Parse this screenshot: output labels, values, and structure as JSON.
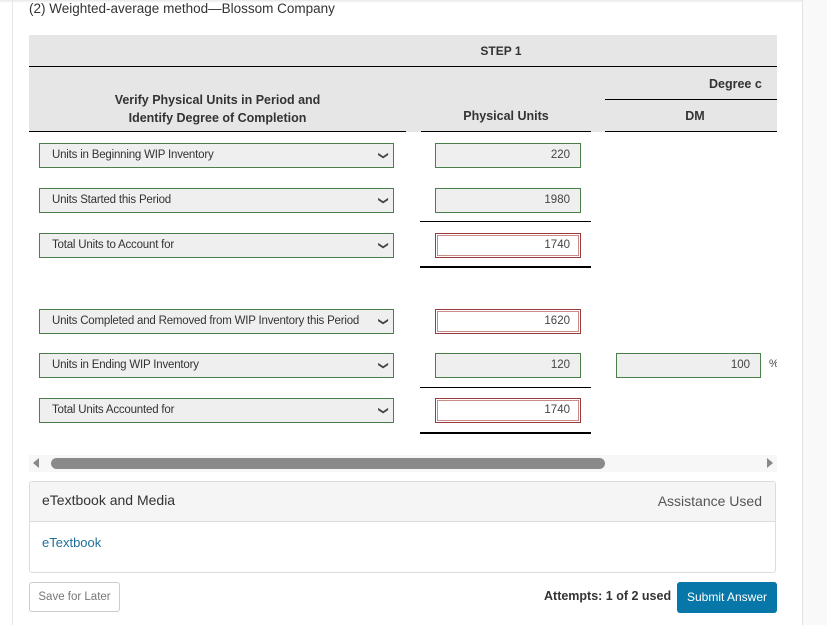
{
  "title": "(2) Weighted-average method—Blossom Company",
  "table": {
    "step_header": "STEP 1",
    "verify_header_line1": "Verify Physical Units in Period and",
    "verify_header_line2": "Identify Degree of Completion",
    "physical_units_header": "Physical Units",
    "degree_header": "Degree c",
    "dm_header": "DM",
    "rows": [
      {
        "label": "Units in Beginning WIP Inventory",
        "physical_units": "220"
      },
      {
        "label": "Units Started this Period",
        "physical_units": "1980"
      },
      {
        "label": "Total Units to Account for",
        "physical_units": "1740"
      },
      {
        "label": "Units Completed and Removed from WIP Inventory this Period",
        "physical_units": "1620"
      },
      {
        "label": "Units in Ending WIP Inventory",
        "physical_units": "120",
        "dm": "100",
        "dm_unit": "%"
      },
      {
        "label": "Total Units Accounted for",
        "physical_units": "1740"
      }
    ]
  },
  "media": {
    "title": "eTextbook and Media",
    "assistance": "Assistance Used",
    "link": "eTextbook"
  },
  "footer": {
    "save_label": "Save for Later",
    "attempts": "Attempts: 1 of 2 used",
    "submit_label": "Submit Answer"
  },
  "colors": {
    "submit_bg": "#0677a8",
    "input_border_ok": "#4a7f4a",
    "input_border_error": "#9b3a3a",
    "link": "#1f6f9b"
  }
}
